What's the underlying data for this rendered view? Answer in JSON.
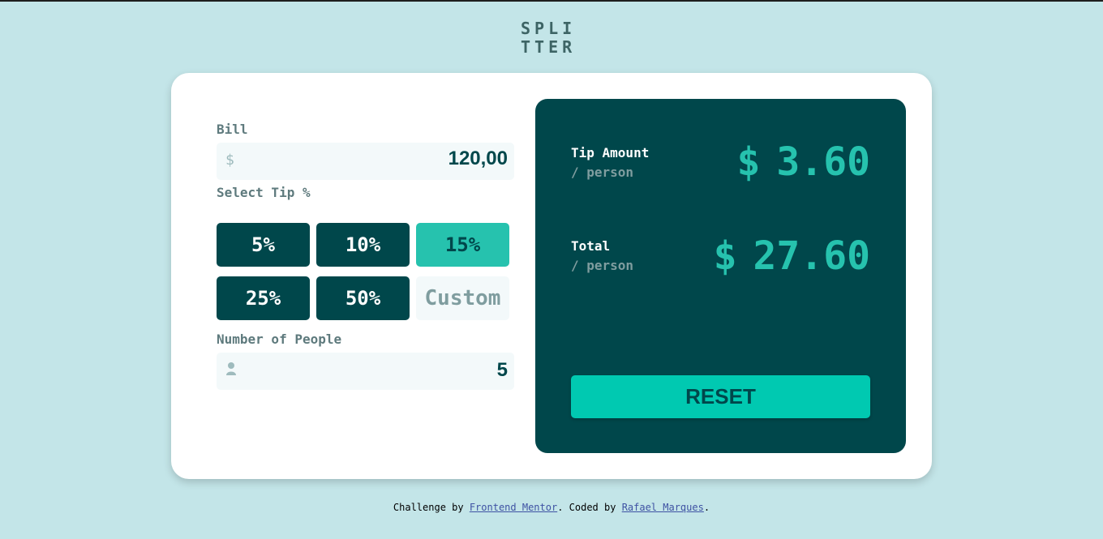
{
  "header": {
    "logo_line1": "SPLI",
    "logo_line2": "TTER"
  },
  "form": {
    "bill_label": "Bill",
    "bill_icon": "dollar-icon",
    "bill_icon_glyph": "$",
    "bill_value": "120,00",
    "tip_label": "Select Tip %",
    "tips": [
      "5%",
      "10%",
      "15%",
      "25%",
      "50%"
    ],
    "selected_tip": "15%",
    "custom_placeholder": "Custom",
    "people_label": "Number of People",
    "people_icon": "person-icon",
    "people_value": "5"
  },
  "results": {
    "tip_title": "Tip Amount",
    "tip_sub": "/ person",
    "tip_currency": "$",
    "tip_value": "3.60",
    "total_title": "Total",
    "total_sub": "/ person",
    "total_currency": "$",
    "total_value": "27.60",
    "reset_label": "RESET"
  },
  "footer": {
    "prefix": "Challenge by ",
    "link1": "Frontend Mentor",
    "middle": ". Coded by ",
    "link2": "Rafael Marques",
    "suffix": "."
  },
  "colors": {
    "background": "#c3e5e8",
    "dark_green": "#00474b",
    "accent": "#26c2ae",
    "reset_bg": "#00c9b1"
  }
}
